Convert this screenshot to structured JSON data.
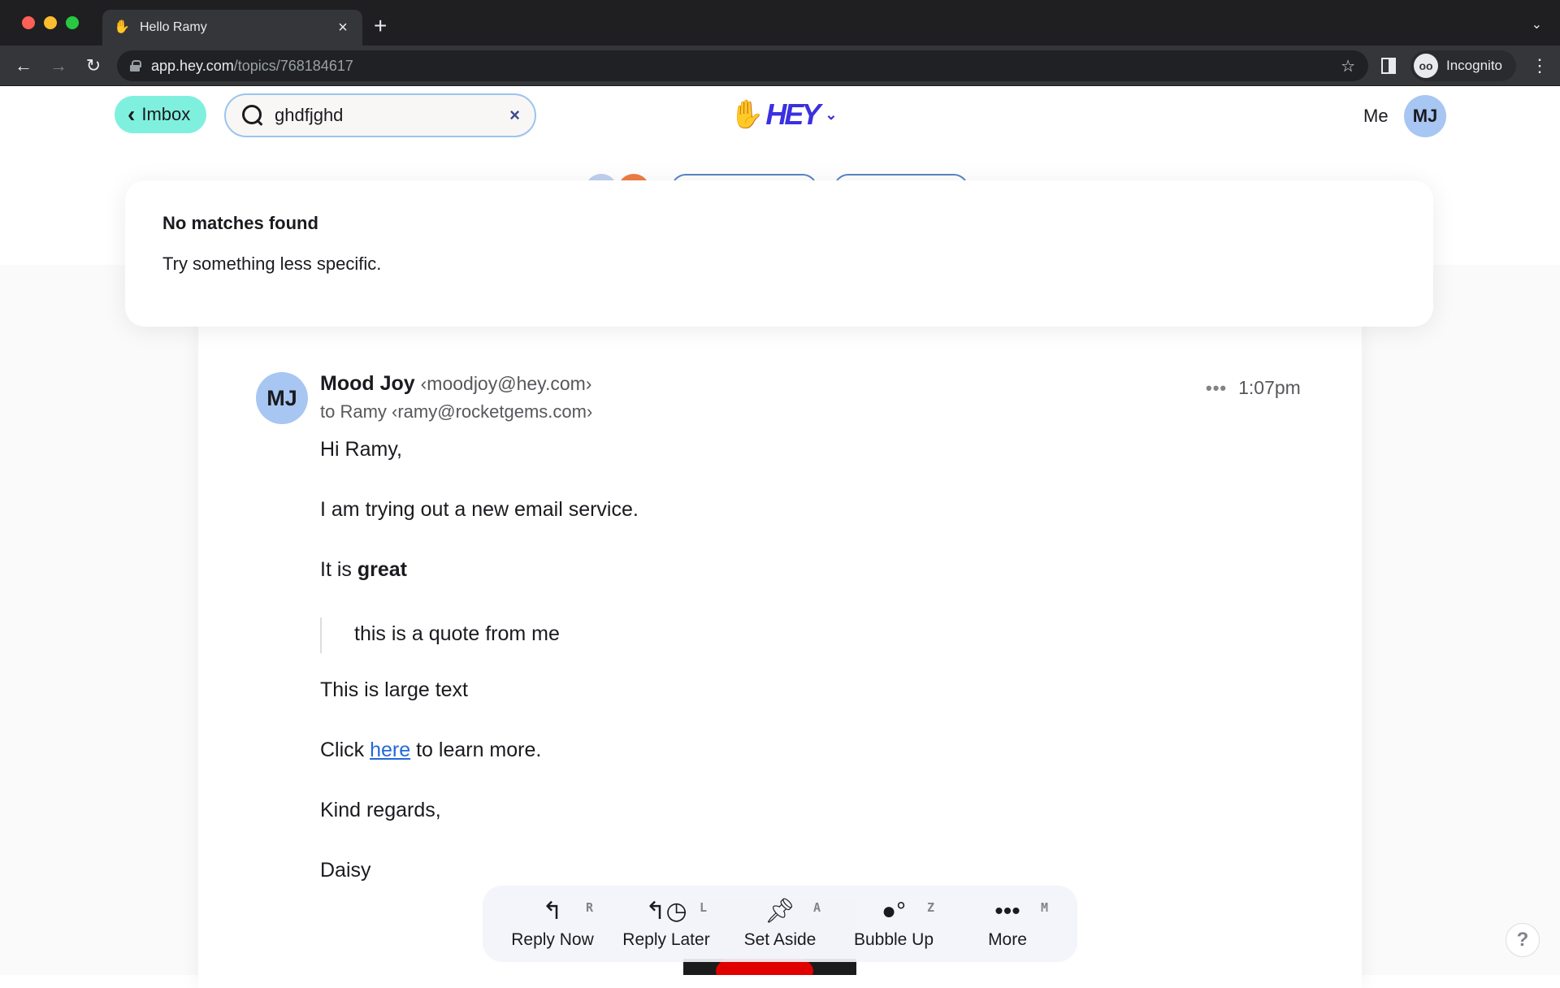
{
  "browser": {
    "tab_title": "Hello Ramy",
    "tab_favicon": "hey-hand-icon",
    "url_host": "app.hey.com",
    "url_path": "/topics/768184617",
    "profile_label": "Incognito"
  },
  "header": {
    "back_label": "Imbox",
    "search": {
      "value": "ghdfjghd",
      "placeholder": ""
    },
    "logo_text": "HEY",
    "me_label": "Me",
    "avatar_initials": "MJ"
  },
  "search_results": {
    "title": "No matches found",
    "message": "Try something less specific."
  },
  "email": {
    "avatar_initials": "MJ",
    "sender_name": "Mood Joy",
    "sender_email": "‹moodjoy@hey.com›",
    "recipient": "to Ramy ‹ramy@rocketgems.com›",
    "time": "1:07pm",
    "body": {
      "greeting": "Hi Ramy,",
      "line1": "I am trying out a new email service.",
      "line2_prefix": "It is ",
      "line2_bold": "great",
      "quote": "this is a quote from me",
      "line3": "This is large text",
      "line4_prefix": "Click ",
      "line4_link": "here",
      "line4_suffix": " to learn more.",
      "signoff": "Kind regards,",
      "signature": "Daisy"
    }
  },
  "actions": [
    {
      "label": "Reply Now",
      "key": "R",
      "icon": "reply-icon"
    },
    {
      "label": "Reply Later",
      "key": "L",
      "icon": "reply-later-icon"
    },
    {
      "label": "Set Aside",
      "key": "A",
      "icon": "pin-icon"
    },
    {
      "label": "Bubble Up",
      "key": "Z",
      "icon": "bubbles-icon"
    },
    {
      "label": "More",
      "key": "M",
      "icon": "more-icon"
    }
  ],
  "help_label": "?",
  "colors": {
    "imbox_button": "#7ff0de",
    "avatar": "#a8c6f2",
    "logo": "#3b30e0",
    "link": "#2369d9"
  }
}
